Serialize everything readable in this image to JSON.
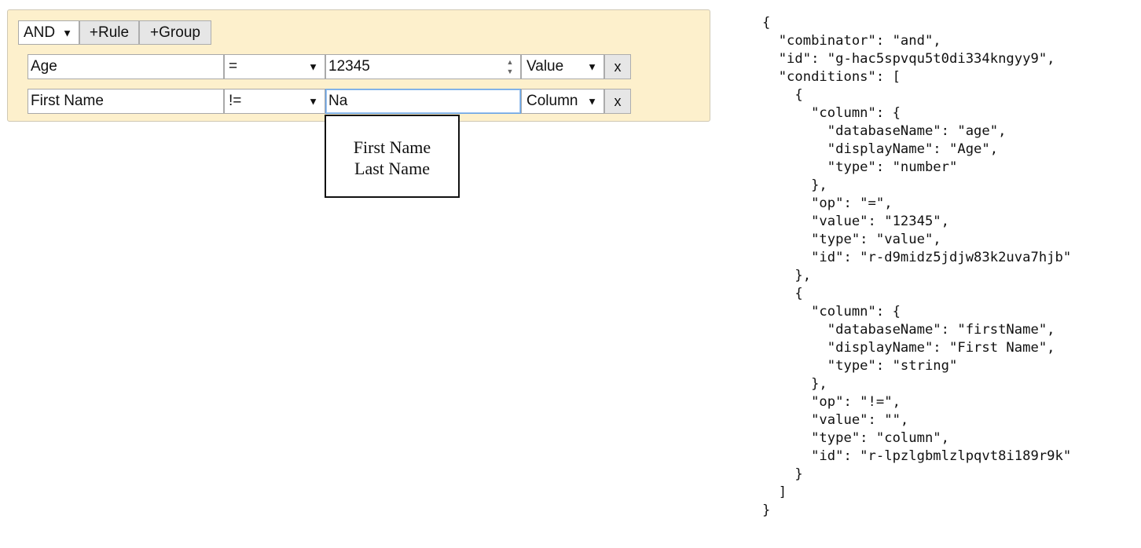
{
  "query_builder": {
    "combinator_label": "AND",
    "add_rule_label": "+Rule",
    "add_group_label": "+Group",
    "rules": [
      {
        "column": "Age",
        "operator": "=",
        "value": "12345",
        "value_type": "Value",
        "remove_label": "x"
      },
      {
        "column": "First Name",
        "operator": "!=",
        "value": "Na",
        "value_type": "Column",
        "remove_label": "x"
      }
    ],
    "suggestions": [
      "First Name",
      "Last Name"
    ]
  },
  "json_output": "{\n  \"combinator\": \"and\",\n  \"id\": \"g-hac5spvqu5t0di334kngyy9\",\n  \"conditions\": [\n    {\n      \"column\": {\n        \"databaseName\": \"age\",\n        \"displayName\": \"Age\",\n        \"type\": \"number\"\n      },\n      \"op\": \"=\",\n      \"value\": \"12345\",\n      \"type\": \"value\",\n      \"id\": \"r-d9midz5jdjw83k2uva7hjb\"\n    },\n    {\n      \"column\": {\n        \"databaseName\": \"firstName\",\n        \"displayName\": \"First Name\",\n        \"type\": \"string\"\n      },\n      \"op\": \"!=\",\n      \"value\": \"\",\n      \"type\": \"column\",\n      \"id\": \"r-lpzlgbmlzlpqvt8i189r9k\"\n    }\n  ]\n}"
}
